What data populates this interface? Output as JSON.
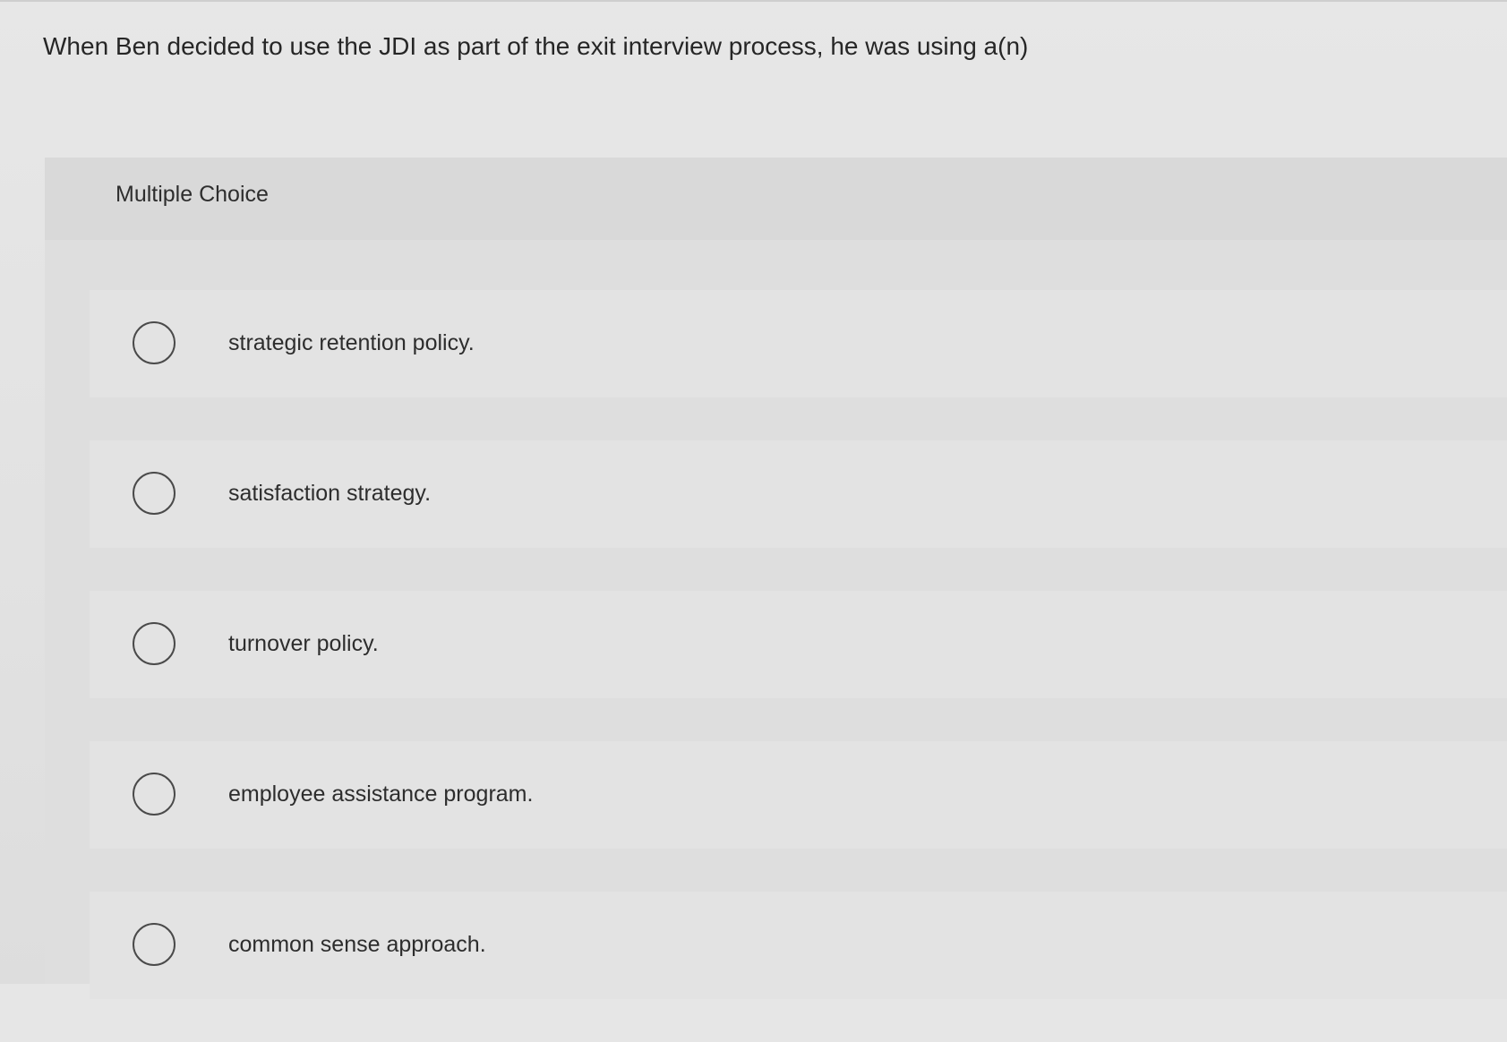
{
  "question": {
    "text": "When Ben decided to use the JDI as part of the exit interview process, he was using a(n)"
  },
  "multiple_choice": {
    "header": "Multiple Choice",
    "options": [
      {
        "label": "strategic retention policy.",
        "selected": false
      },
      {
        "label": "satisfaction strategy.",
        "selected": false
      },
      {
        "label": "turnover policy.",
        "selected": false
      },
      {
        "label": "employee assistance program.",
        "selected": false
      },
      {
        "label": "common sense approach.",
        "selected": false
      }
    ]
  },
  "icons": {
    "radio": "radio-button-unselected-icon"
  }
}
